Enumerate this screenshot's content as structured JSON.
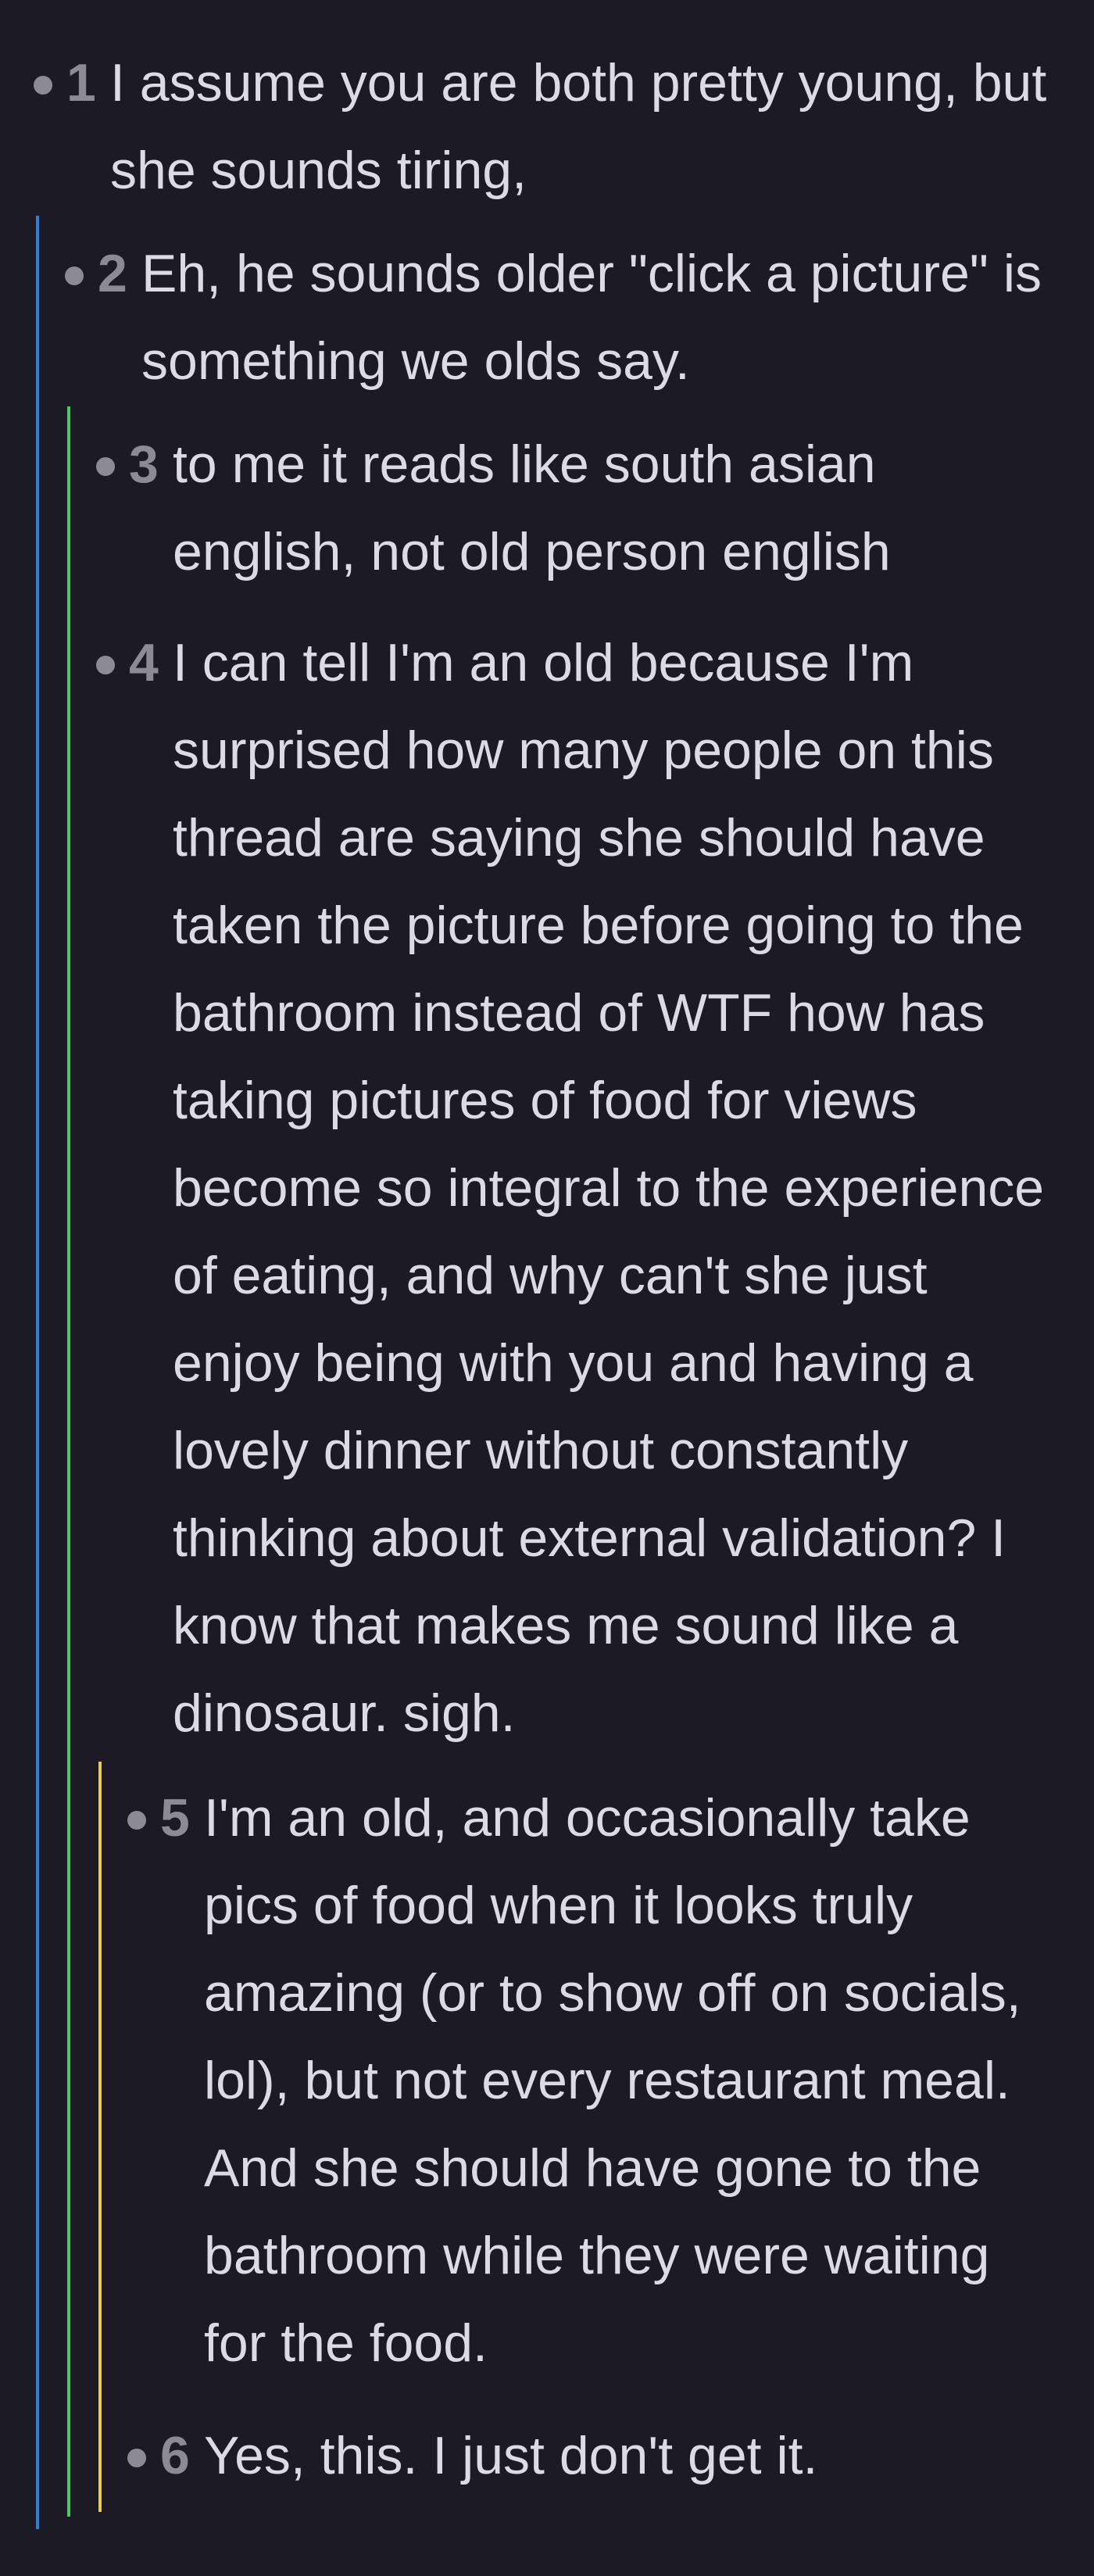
{
  "colors": {
    "background": "#1c1a24",
    "text": "#dcdae4",
    "muted": "#8c8a94",
    "depth_line_1": "#2f7fd0",
    "depth_line_2": "#4cc865",
    "depth_line_3": "#e8cc4a"
  },
  "thread": {
    "comments": [
      {
        "number": "1",
        "depth": 0,
        "text": "I assume you are both pretty young, but she sounds tiring,"
      },
      {
        "number": "2",
        "depth": 1,
        "text": "Eh, he sounds older \"click a picture\" is something we olds say."
      },
      {
        "number": "3",
        "depth": 2,
        "text": "to me it reads like south asian english, not old person english"
      },
      {
        "number": "4",
        "depth": 2,
        "text": "I can tell I'm an old because I'm surprised how many people on this thread are saying she should have taken the picture before going to the bathroom instead of WTF how has taking pictures of food for views become so integral to the experience of eating, and why can't she just enjoy being with you and having a lovely dinner without constantly thinking about external validation? I know that makes me sound like a dinosaur. sigh."
      },
      {
        "number": "5",
        "depth": 3,
        "text": "I'm an old, and occasionally take pics of food when it looks truly amazing (or to show off on socials, lol), but not every restaurant meal. And she should have gone to the bathroom while they were waiting for the food."
      },
      {
        "number": "6",
        "depth": 3,
        "text": "Yes, this. I just don't get it."
      }
    ]
  }
}
